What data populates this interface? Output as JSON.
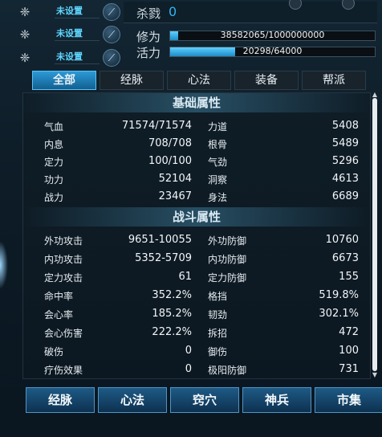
{
  "slots": [
    {
      "label": "未设置",
      "icon": "gem-icon"
    },
    {
      "label": "未设置",
      "icon": "gem-icon"
    },
    {
      "label": "未设置",
      "icon": "gem-icon"
    }
  ],
  "kill": {
    "label": "杀戮",
    "value": "0"
  },
  "bars": [
    {
      "label": "修为",
      "text": "38582065/1000000000",
      "fill": 0.0386
    },
    {
      "label": "活力",
      "text": "20298/64000",
      "fill": 0.317
    }
  ],
  "tabs": [
    "全部",
    "经脉",
    "心法",
    "装备",
    "帮派"
  ],
  "active_tab": 0,
  "sections": [
    {
      "title": "基础属性",
      "rows": [
        [
          "气血",
          "71574/71574",
          "力道",
          "5408"
        ],
        [
          "内息",
          "708/708",
          "根骨",
          "5489"
        ],
        [
          "定力",
          "100/100",
          "气劲",
          "5296"
        ],
        [
          "功力",
          "52104",
          "洞察",
          "4613"
        ],
        [
          "战力",
          "23467",
          "身法",
          "6689"
        ]
      ]
    },
    {
      "title": "战斗属性",
      "rows": [
        [
          "外功攻击",
          "9651-10055",
          "外功防御",
          "10760"
        ],
        [
          "内功攻击",
          "5352-5709",
          "内功防御",
          "6673"
        ],
        [
          "定力攻击",
          "61",
          "定力防御",
          "155"
        ],
        [
          "命中率",
          "352.2%",
          "格挡",
          "519.8%"
        ],
        [
          "会心率",
          "185.2%",
          "韧劲",
          "302.1%"
        ],
        [
          "会心伤害",
          "222.2%",
          "拆招",
          "472"
        ],
        [
          "破伤",
          "0",
          "御伤",
          "100"
        ],
        [
          "疗伤效果",
          "0",
          "极阳防御",
          "731"
        ]
      ]
    }
  ],
  "bottom_buttons": [
    "经脉",
    "心法",
    "窍穴",
    "神兵",
    "市集"
  ],
  "colors": {
    "accent": "#2b9ad8",
    "value_blue": "#32b4ee",
    "slot_label": "#5fd6ff"
  }
}
